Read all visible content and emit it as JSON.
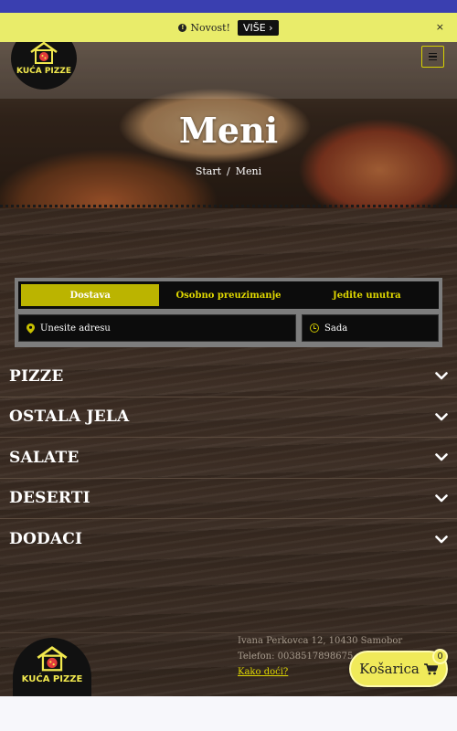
{
  "notice": {
    "text": "Novost!",
    "more_label": "VIŠE ›",
    "close_label": "×"
  },
  "header": {
    "brand": "KUĆA PIZZE"
  },
  "hero": {
    "title": "Meni",
    "breadcrumb": [
      "Start",
      "Meni"
    ],
    "breadcrumb_sep": "/"
  },
  "order": {
    "tabs": [
      {
        "label": "Dostava",
        "active": true
      },
      {
        "label": "Osobno preuzimanje",
        "active": false
      },
      {
        "label": "Jedite unutra",
        "active": false
      }
    ],
    "address_placeholder": "Unesite adresu",
    "time_value": "Sada"
  },
  "categories": [
    {
      "label": "PIZZE"
    },
    {
      "label": "OSTALA JELA"
    },
    {
      "label": "SALATE"
    },
    {
      "label": "DESERTI"
    },
    {
      "label": "DODACI"
    }
  ],
  "footer": {
    "brand": "KUĆA PIZZE",
    "address": "Ivana Perkovca 12, 10430 Samobor",
    "phone": "Telefon: 0038517898675",
    "directions_link": "Kako doći?"
  },
  "cart": {
    "label": "Košarica",
    "count": "0"
  },
  "colors": {
    "accent": "#bbb400",
    "notice_bg": "#e9ec6a",
    "top_bar": "#3a3fb0",
    "cart_bg": "#f0ea5a"
  }
}
